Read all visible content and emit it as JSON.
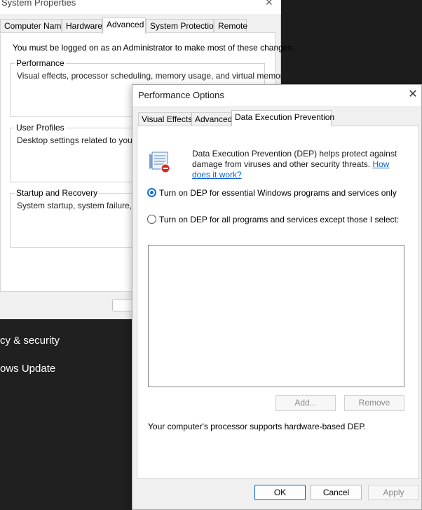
{
  "system_properties": {
    "title": "System Properties",
    "close_glyph": "✕",
    "tabs": [
      "Computer Name",
      "Hardware",
      "Advanced",
      "System Protection",
      "Remote"
    ],
    "active_tab": "Advanced",
    "admin_note": "You must be logged on as an Administrator to make most of these changes.",
    "groups": {
      "performance": {
        "label": "Performance",
        "desc": "Visual effects, processor scheduling, memory usage, and virtual memory"
      },
      "user_profiles": {
        "label": "User Profiles",
        "desc": "Desktop settings related to your sig"
      },
      "startup_recovery": {
        "label": "Startup and Recovery",
        "desc": "System startup, system failure, and"
      }
    }
  },
  "settings_nav": {
    "items": [
      "cy & security",
      "ows Update"
    ]
  },
  "performance_options": {
    "title": "Performance Options",
    "close_glyph": "✕",
    "tabs": [
      "Visual Effects",
      "Advanced",
      "Data Execution Prevention"
    ],
    "active_tab": "Data Execution Prevention",
    "dep_description": "Data Execution Prevention (DEP) helps protect against damage from viruses and other security threats.",
    "dep_link": "How does it work?",
    "radio_essential": "Turn on DEP for essential Windows programs and services only",
    "radio_all": "Turn on DEP for all programs and services except those I select:",
    "selected_option": "essential",
    "add_button": "Add...",
    "remove_button": "Remove",
    "support_note": "Your computer's processor supports hardware-based DEP.",
    "ok_button": "OK",
    "cancel_button": "Cancel",
    "apply_button": "Apply"
  },
  "colors": {
    "accent": "#1a6fd0",
    "link": "#0a64c8",
    "dark_background": "#202020"
  }
}
